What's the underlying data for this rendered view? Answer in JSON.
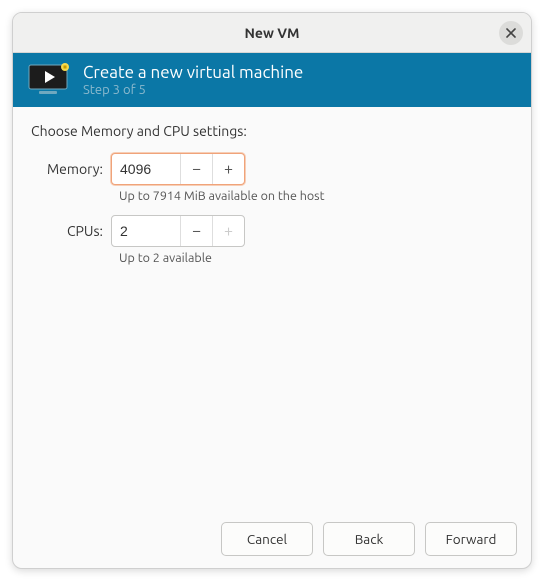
{
  "window": {
    "title": "New VM"
  },
  "banner": {
    "title": "Create a new virtual machine",
    "step": "Step 3 of 5"
  },
  "form": {
    "heading": "Choose Memory and CPU settings:",
    "memory": {
      "label": "Memory:",
      "value": "4096",
      "hint": "Up to 7914 MiB available on the host"
    },
    "cpus": {
      "label": "CPUs:",
      "value": "2",
      "hint": "Up to 2 available"
    }
  },
  "buttons": {
    "cancel": "Cancel",
    "back": "Back",
    "forward": "Forward"
  }
}
